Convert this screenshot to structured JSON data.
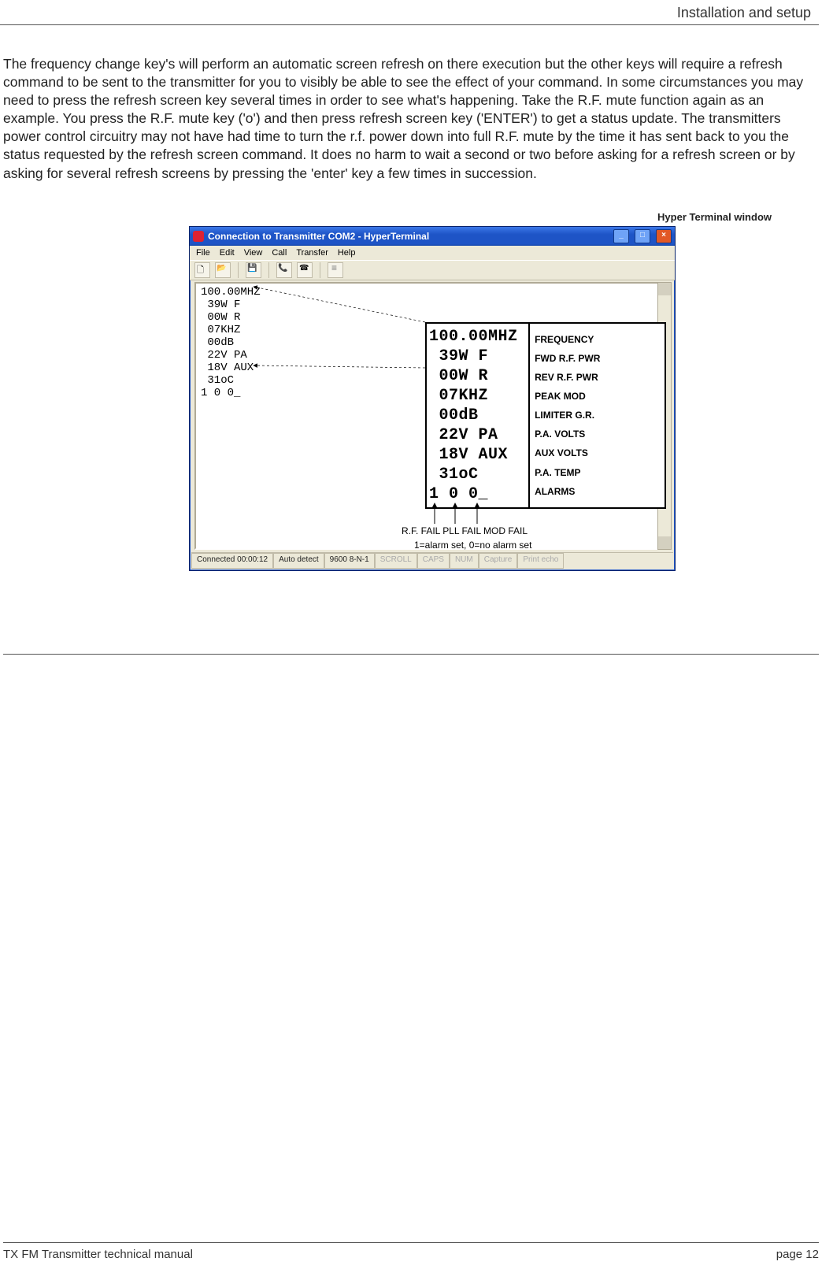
{
  "header": {
    "section_title": "Installation and setup"
  },
  "body_paragraph": "The frequency change key's will perform an automatic screen refresh on there execution but the other keys will require a refresh command to be sent to the transmitter for you to visibly be able to see the effect of your command. In some circumstances you may need to press the refresh screen key several times in order to see what's happening. Take the R.F. mute function again as an example. You press the R.F. mute key ('o') and then press refresh screen key ('ENTER') to get a status update. The transmitters power control circuitry may not have had time to turn the r.f. power down into full R.F. mute by the time it has sent back to you the status requested by the refresh screen command. It does no harm to wait a second or two before asking for a refresh screen or by asking for several refresh screens by pressing the 'enter' key a few times in succession.",
  "figure_caption": "Hyper Terminal window",
  "window": {
    "title": "Connection to Transmitter COM2 - HyperTerminal",
    "menu": [
      "File",
      "Edit",
      "View",
      "Call",
      "Transfer",
      "Help"
    ],
    "terminal_lines": "100.00MHZ\n 39W F\n 00W R\n 07KHZ\n 00dB\n 22V PA\n 18V AUX\n 31oC\n1 0 0_",
    "statusbar": {
      "connected": "Connected 00:00:12",
      "auto": "Auto detect",
      "settings": "9600 8-N-1",
      "scroll": "SCROLL",
      "caps": "CAPS",
      "num": "NUM",
      "capture": "Capture",
      "print": "Print echo"
    }
  },
  "detail": {
    "lines": "100.00MHZ\n 39W F\n 00W R\n 07KHZ\n 00dB\n 22V PA\n 18V AUX\n 31oC\n1 0 0_",
    "labels": [
      "FREQUENCY",
      "FWD R.F. PWR",
      "REV R.F. PWR",
      "PEAK MOD",
      "LIMITER G.R.",
      "P.A. VOLTS",
      "AUX VOLTS",
      "P.A. TEMP",
      "ALARMS"
    ]
  },
  "alarm_labels": "R.F. FAIL  PLL FAIL  MOD FAIL",
  "alarm_note": "1=alarm set, 0=no alarm set",
  "footer": {
    "left": "TX FM Transmitter technical manual",
    "right": "page 12"
  }
}
